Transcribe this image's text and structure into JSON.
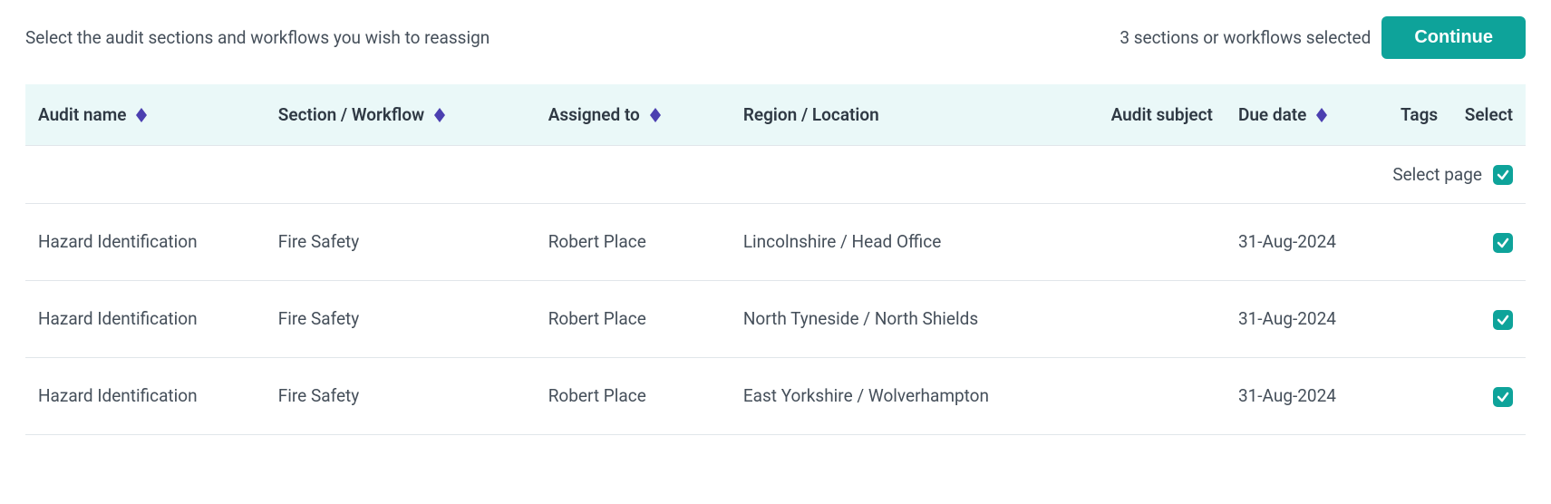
{
  "top": {
    "prompt": "Select the audit sections and workflows you wish to reassign",
    "selected_status": "3 sections or workflows selected",
    "continue_label": "Continue"
  },
  "columns": {
    "audit_name": "Audit name",
    "section_workflow": "Section / Workflow",
    "assigned_to": "Assigned to",
    "region_location": "Region / Location",
    "audit_subject": "Audit subject",
    "due_date": "Due date",
    "tags": "Tags",
    "select": "Select"
  },
  "select_page": {
    "label": "Select page",
    "checked": true
  },
  "rows": [
    {
      "audit_name": "Hazard Identification",
      "section_workflow": "Fire Safety",
      "assigned_to": "Robert Place",
      "region_location": "Lincolnshire / Head Office",
      "audit_subject": "",
      "due_date": "31-Aug-2024",
      "tags": "",
      "selected": true
    },
    {
      "audit_name": "Hazard Identification",
      "section_workflow": "Fire Safety",
      "assigned_to": "Robert Place",
      "region_location": "North Tyneside / North Shields",
      "audit_subject": "",
      "due_date": "31-Aug-2024",
      "tags": "",
      "selected": true
    },
    {
      "audit_name": "Hazard Identification",
      "section_workflow": "Fire Safety",
      "assigned_to": "Robert Place",
      "region_location": "East Yorkshire / Wolverhampton",
      "audit_subject": "",
      "due_date": "31-Aug-2024",
      "tags": "",
      "selected": true
    }
  ]
}
